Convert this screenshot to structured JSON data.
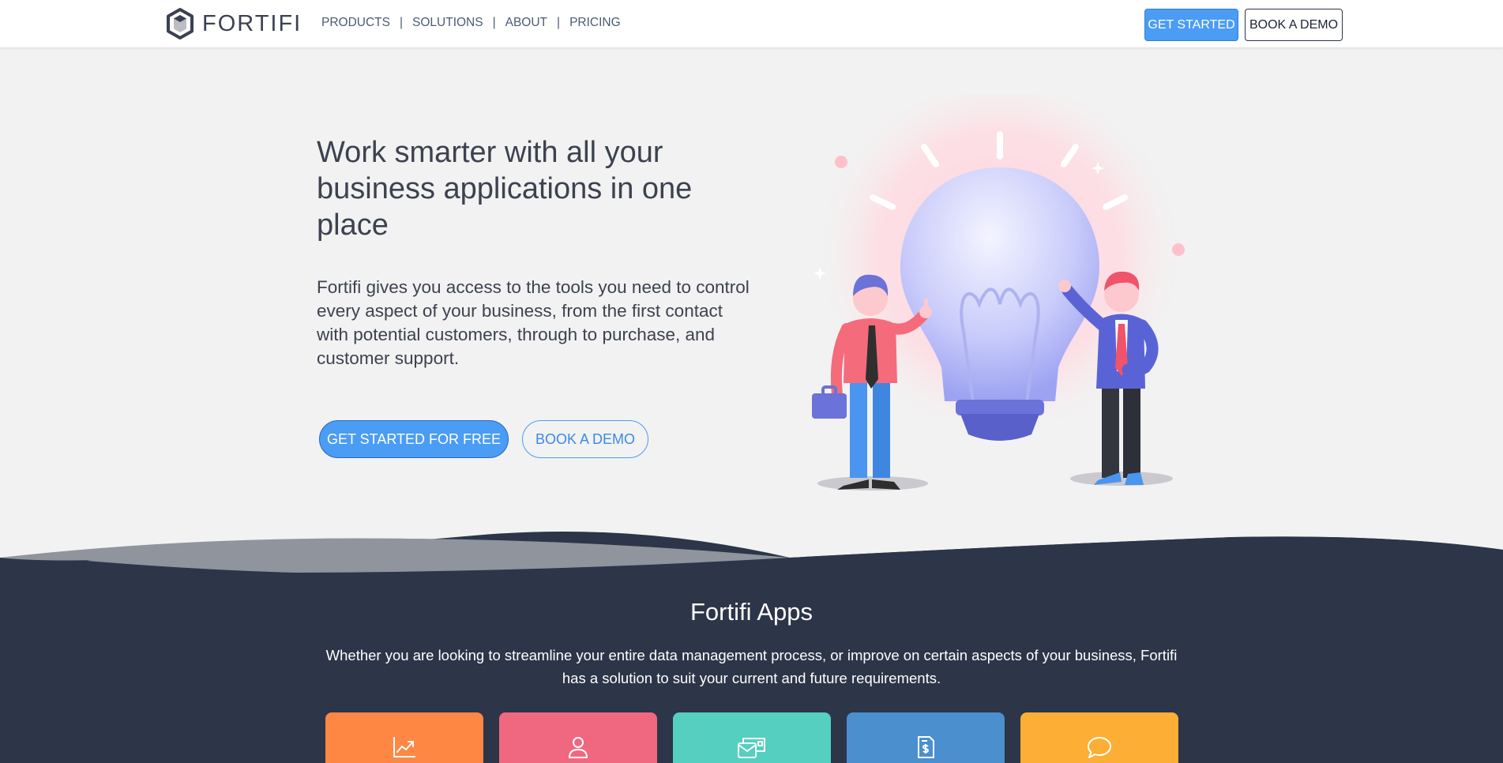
{
  "header": {
    "logo_text": "FORTIFI",
    "nav": [
      {
        "label": "PRODUCTS"
      },
      {
        "label": "SOLUTIONS"
      },
      {
        "label": "ABOUT"
      },
      {
        "label": "PRICING"
      }
    ],
    "nav_separator": "|",
    "get_started_label": "GET STARTED",
    "book_demo_label": "BOOK A DEMO"
  },
  "hero": {
    "title": "Work smarter with all your business applications in one place",
    "description": "Fortifi gives you access to the tools you need to control every aspect of your business, from the first contact with potential customers, through to purchase, and customer support.",
    "primary_button": "GET STARTED FOR FREE",
    "secondary_button": "BOOK A DEMO"
  },
  "apps": {
    "title": "Fortifi Apps",
    "description": "Whether you are looking to streamline your entire data management process, or improve on certain aspects of your business, Fortifi has a solution to suit your current and future requirements.",
    "cards": [
      {
        "icon": "chart-trend-icon",
        "color": "#ff8744"
      },
      {
        "icon": "user-icon",
        "color": "#f0687f"
      },
      {
        "icon": "mail-cards-icon",
        "color": "#55cfc0"
      },
      {
        "icon": "invoice-dollar-icon",
        "color": "#4b8fcf"
      },
      {
        "icon": "chat-bubble-icon",
        "color": "#fcae35"
      }
    ]
  },
  "colors": {
    "accent": "#4a9cf5",
    "dark_section": "#2d3548",
    "hero_bg": "#f2f2f2"
  }
}
